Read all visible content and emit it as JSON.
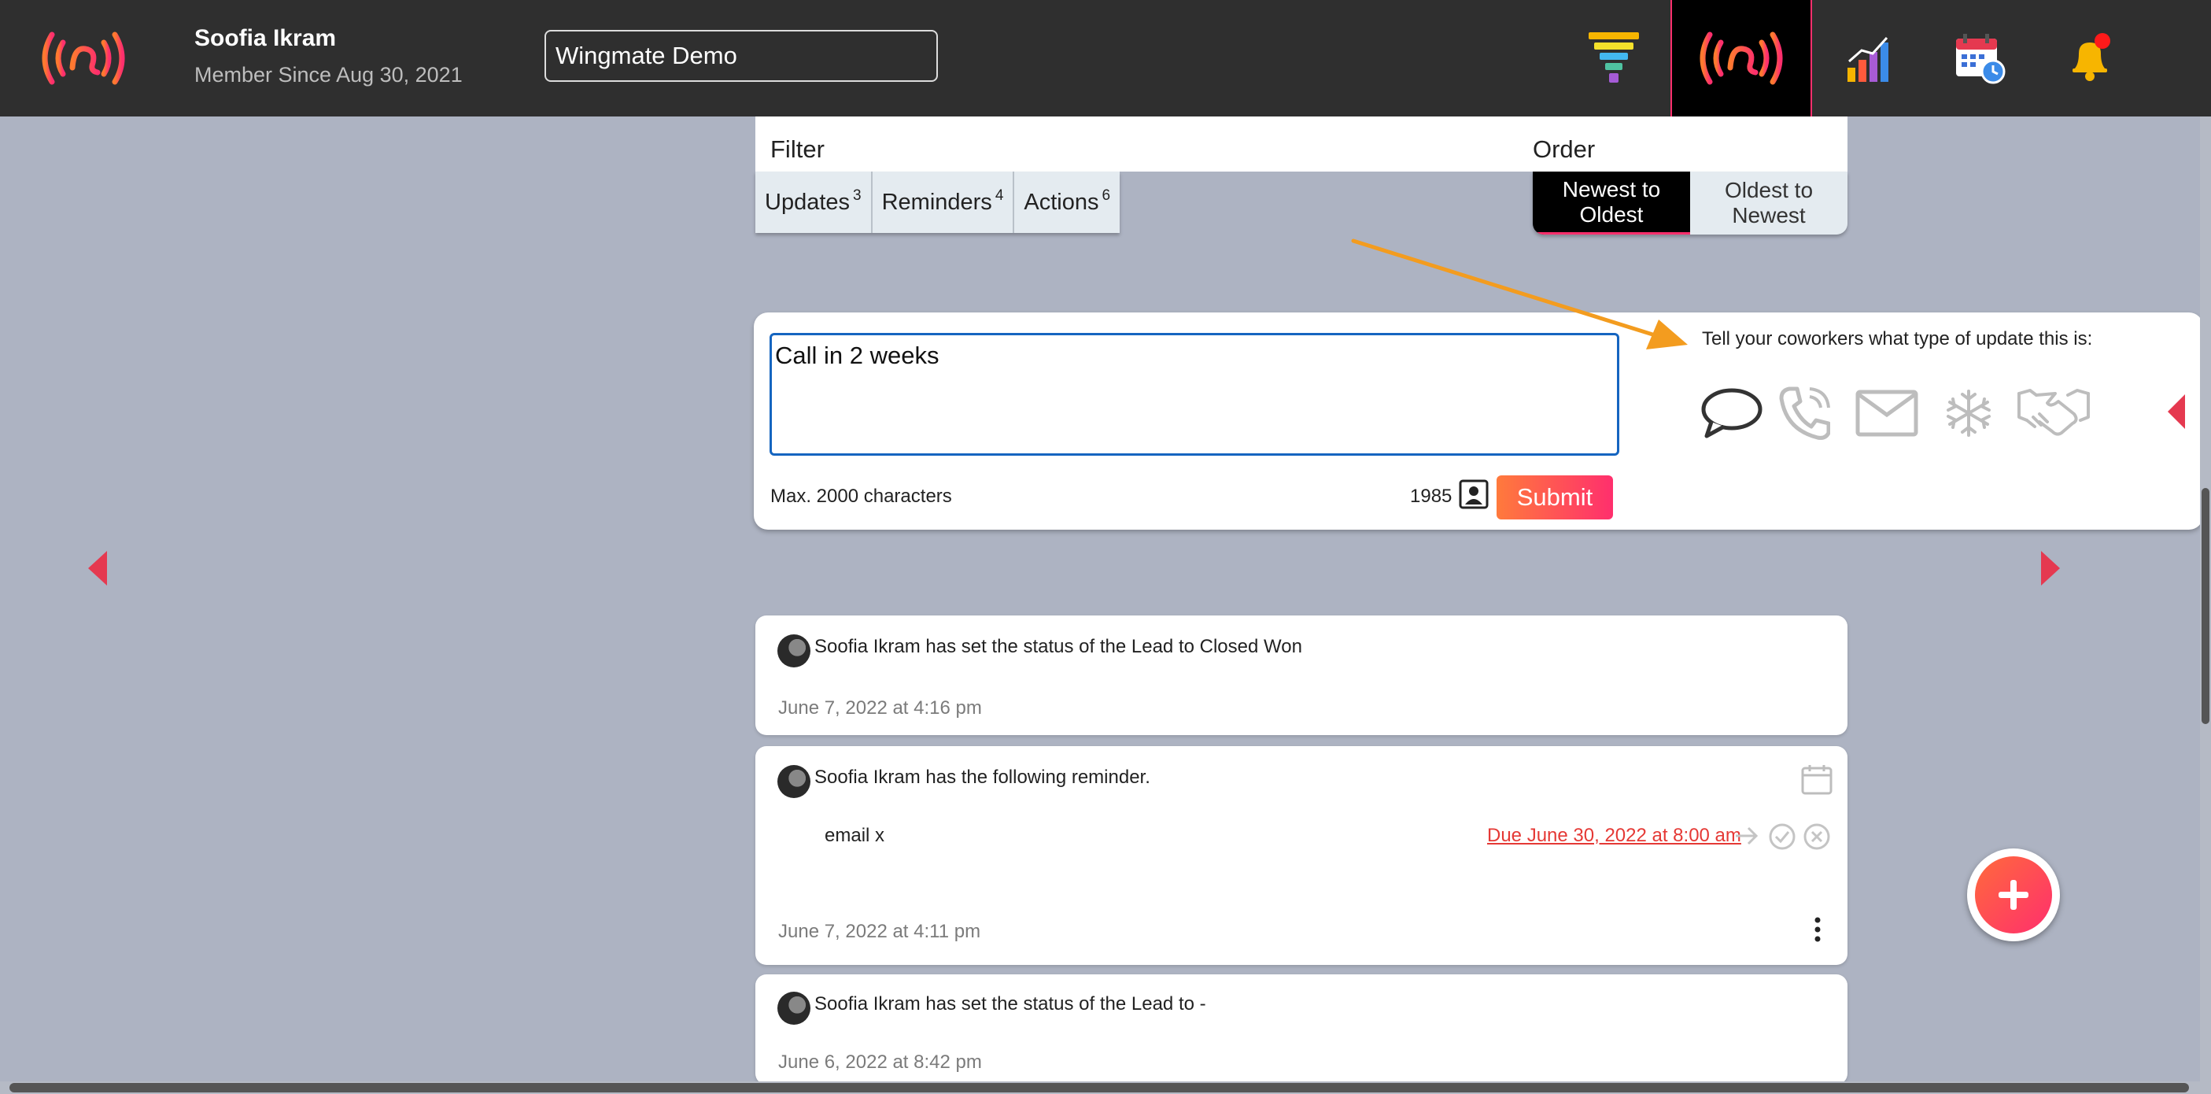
{
  "header": {
    "user_name": "Soofia Ikram",
    "member_since": "Member Since Aug 30, 2021",
    "project_value": "Wingmate Demo",
    "icons": [
      "wingmate-logo",
      "funnel-icon",
      "wingmate-signal-icon",
      "analytics-chart-icon",
      "calendar-clock-icon",
      "notification-bell-icon"
    ],
    "active_icon": "wingmate-signal-icon",
    "notification_dot": true
  },
  "filter": {
    "title": "Filter",
    "tabs": [
      {
        "label": "Updates",
        "count": "3"
      },
      {
        "label": "Reminders",
        "count": "4"
      },
      {
        "label": "Actions",
        "count": "6"
      }
    ]
  },
  "order": {
    "title": "Order",
    "options": [
      {
        "line1": "Newest to",
        "line2": "Oldest",
        "selected": true
      },
      {
        "line1": "Oldest to",
        "line2": "Newest",
        "selected": false
      }
    ]
  },
  "composer": {
    "text": "Call in 2 weeks",
    "max_label": "Max. 2000 characters",
    "remaining": "1985",
    "submit_label": "Submit",
    "prompt": "Tell your coworkers what type of update this is:",
    "update_types": [
      "chat-bubble-icon",
      "phone-icon",
      "email-icon",
      "snowflake-icon",
      "handshake-icon"
    ]
  },
  "feed": [
    {
      "author": "Soofia Ikram",
      "message": "Soofia Ikram has set the status of the Lead to Closed Won",
      "date": "June 7, 2022 at 4:16 pm"
    },
    {
      "author": "Soofia Ikram",
      "message": "Soofia Ikram has the following reminder.",
      "reminder": "email x",
      "due": "Due June 30, 2022 at 8:00 am",
      "date": "June 7, 2022 at 4:11 pm"
    },
    {
      "author": "Soofia Ikram",
      "message": "Soofia Ikram has set the status of the Lead to -",
      "date": "June 6, 2022 at 8:42 pm"
    }
  ],
  "colors": {
    "accent": "#ff2f6d",
    "header_bg": "#2f2f2f",
    "page_bg": "#adb3c2",
    "arrow": "#f39c1f",
    "due_red": "#e53935",
    "focus_blue": "#1565c0"
  }
}
